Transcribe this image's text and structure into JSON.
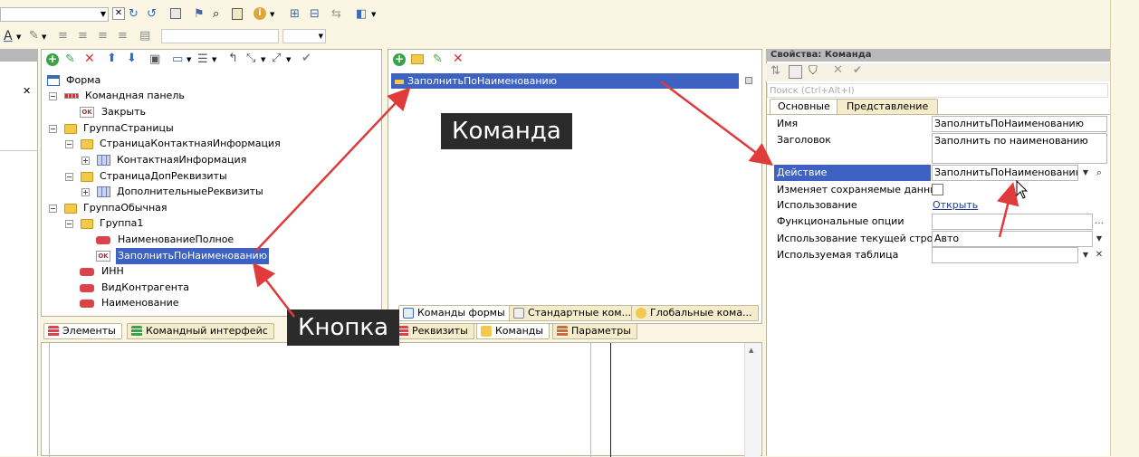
{
  "left_tree": {
    "items": [
      {
        "label": "Форма",
        "icon": "form-icon"
      },
      {
        "label": "Командная панель",
        "icon": "command-panel-icon"
      },
      {
        "label": "Закрыть",
        "icon": "button-icon"
      },
      {
        "label": "ГруппаСтраницы",
        "icon": "folder-icon"
      },
      {
        "label": "СтраницаКонтактнаяИнформация",
        "icon": "folder-icon"
      },
      {
        "label": "КонтактнаяИнформация",
        "icon": "table-icon"
      },
      {
        "label": "СтраницаДопРеквизиты",
        "icon": "folder-icon"
      },
      {
        "label": "ДополнительныеРеквизиты",
        "icon": "table-icon"
      },
      {
        "label": "ГруппаОбычная",
        "icon": "folder-icon"
      },
      {
        "label": "Группа1",
        "icon": "folder-icon"
      },
      {
        "label": "НаименованиеПолное",
        "icon": "field-icon"
      },
      {
        "label": "ЗаполнитьПоНаименованию",
        "icon": "button-icon"
      },
      {
        "label": "ИНН",
        "icon": "field-icon"
      },
      {
        "label": "ВидКонтрагента",
        "icon": "field-icon"
      },
      {
        "label": "Наименование",
        "icon": "field-icon"
      }
    ],
    "tabs": [
      "Элементы",
      "Командный интерфейс"
    ]
  },
  "commands": {
    "items": [
      "ЗаполнитьПоНаименованию"
    ],
    "tabs": [
      "Команды формы",
      "Стандартные ком...",
      "Глобальные кома..."
    ],
    "bottom_tabs": [
      "Реквизиты",
      "Команды",
      "Параметры"
    ]
  },
  "callouts": {
    "command": "Команда",
    "button": "Кнопка"
  },
  "props": {
    "title": "Свойства: Команда",
    "search_placeholder": "Поиск (Ctrl+Alt+I)",
    "tabs": [
      "Основные",
      "Представление"
    ],
    "rows": {
      "name_label": "Имя",
      "name_value": "ЗаполнитьПоНаименованию",
      "caption_label": "Заголовок",
      "caption_value": "Заполнить по наименованию",
      "action_label": "Действие",
      "action_value": "ЗаполнитьПоНаименованию",
      "modifies_label": "Изменяет сохраняемые данные",
      "use_label": "Использование",
      "use_link": "Открыть",
      "func_label": "Функциональные опции",
      "func_value": "",
      "current_row_label": "Использование текущей строки",
      "current_row_value": "Авто",
      "table_label": "Используемая таблица",
      "table_value": ""
    }
  },
  "colors": {
    "selection": "#3d62c2",
    "arrow": "#e03a3a",
    "callout_bg": "#2b2b2b"
  }
}
